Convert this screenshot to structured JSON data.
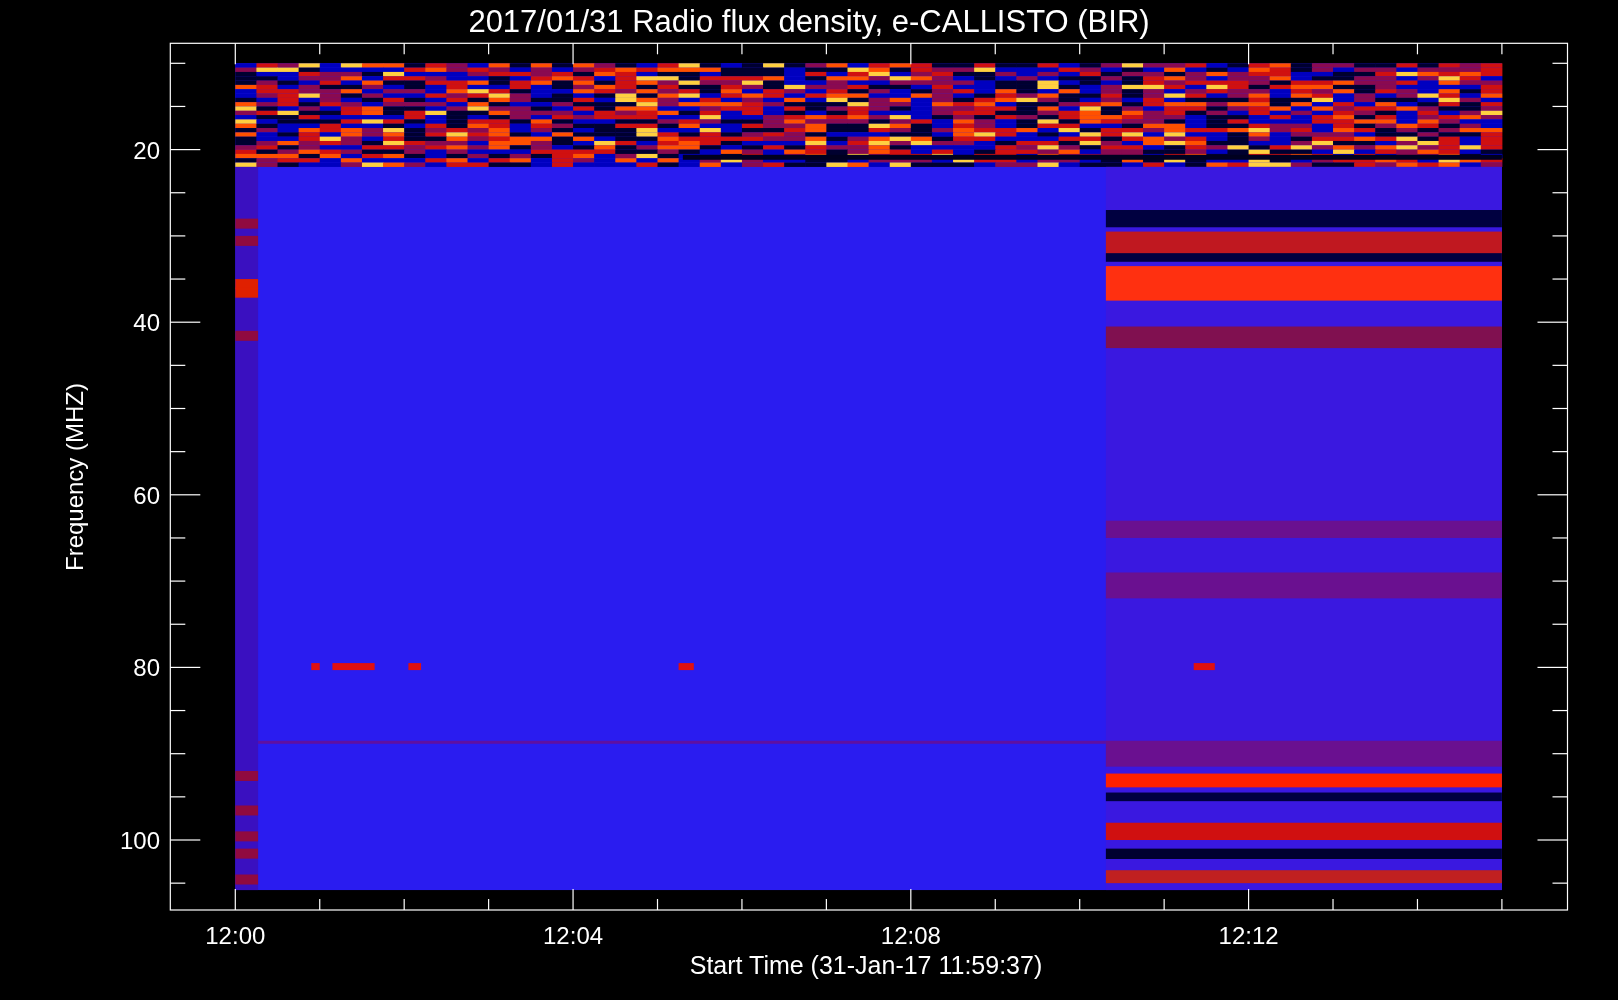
{
  "title": "2017/01/31  Radio flux density, e-CALLISTO (BIR)",
  "y_axis": {
    "label": "Frequency (MHZ)",
    "ticks": [
      "20",
      "40",
      "60",
      "80",
      "100"
    ]
  },
  "x_axis": {
    "label": "Start Time (31-Jan-17 11:59:37)",
    "ticks": [
      "12:00",
      "12:04",
      "12:08",
      "12:12"
    ]
  }
}
